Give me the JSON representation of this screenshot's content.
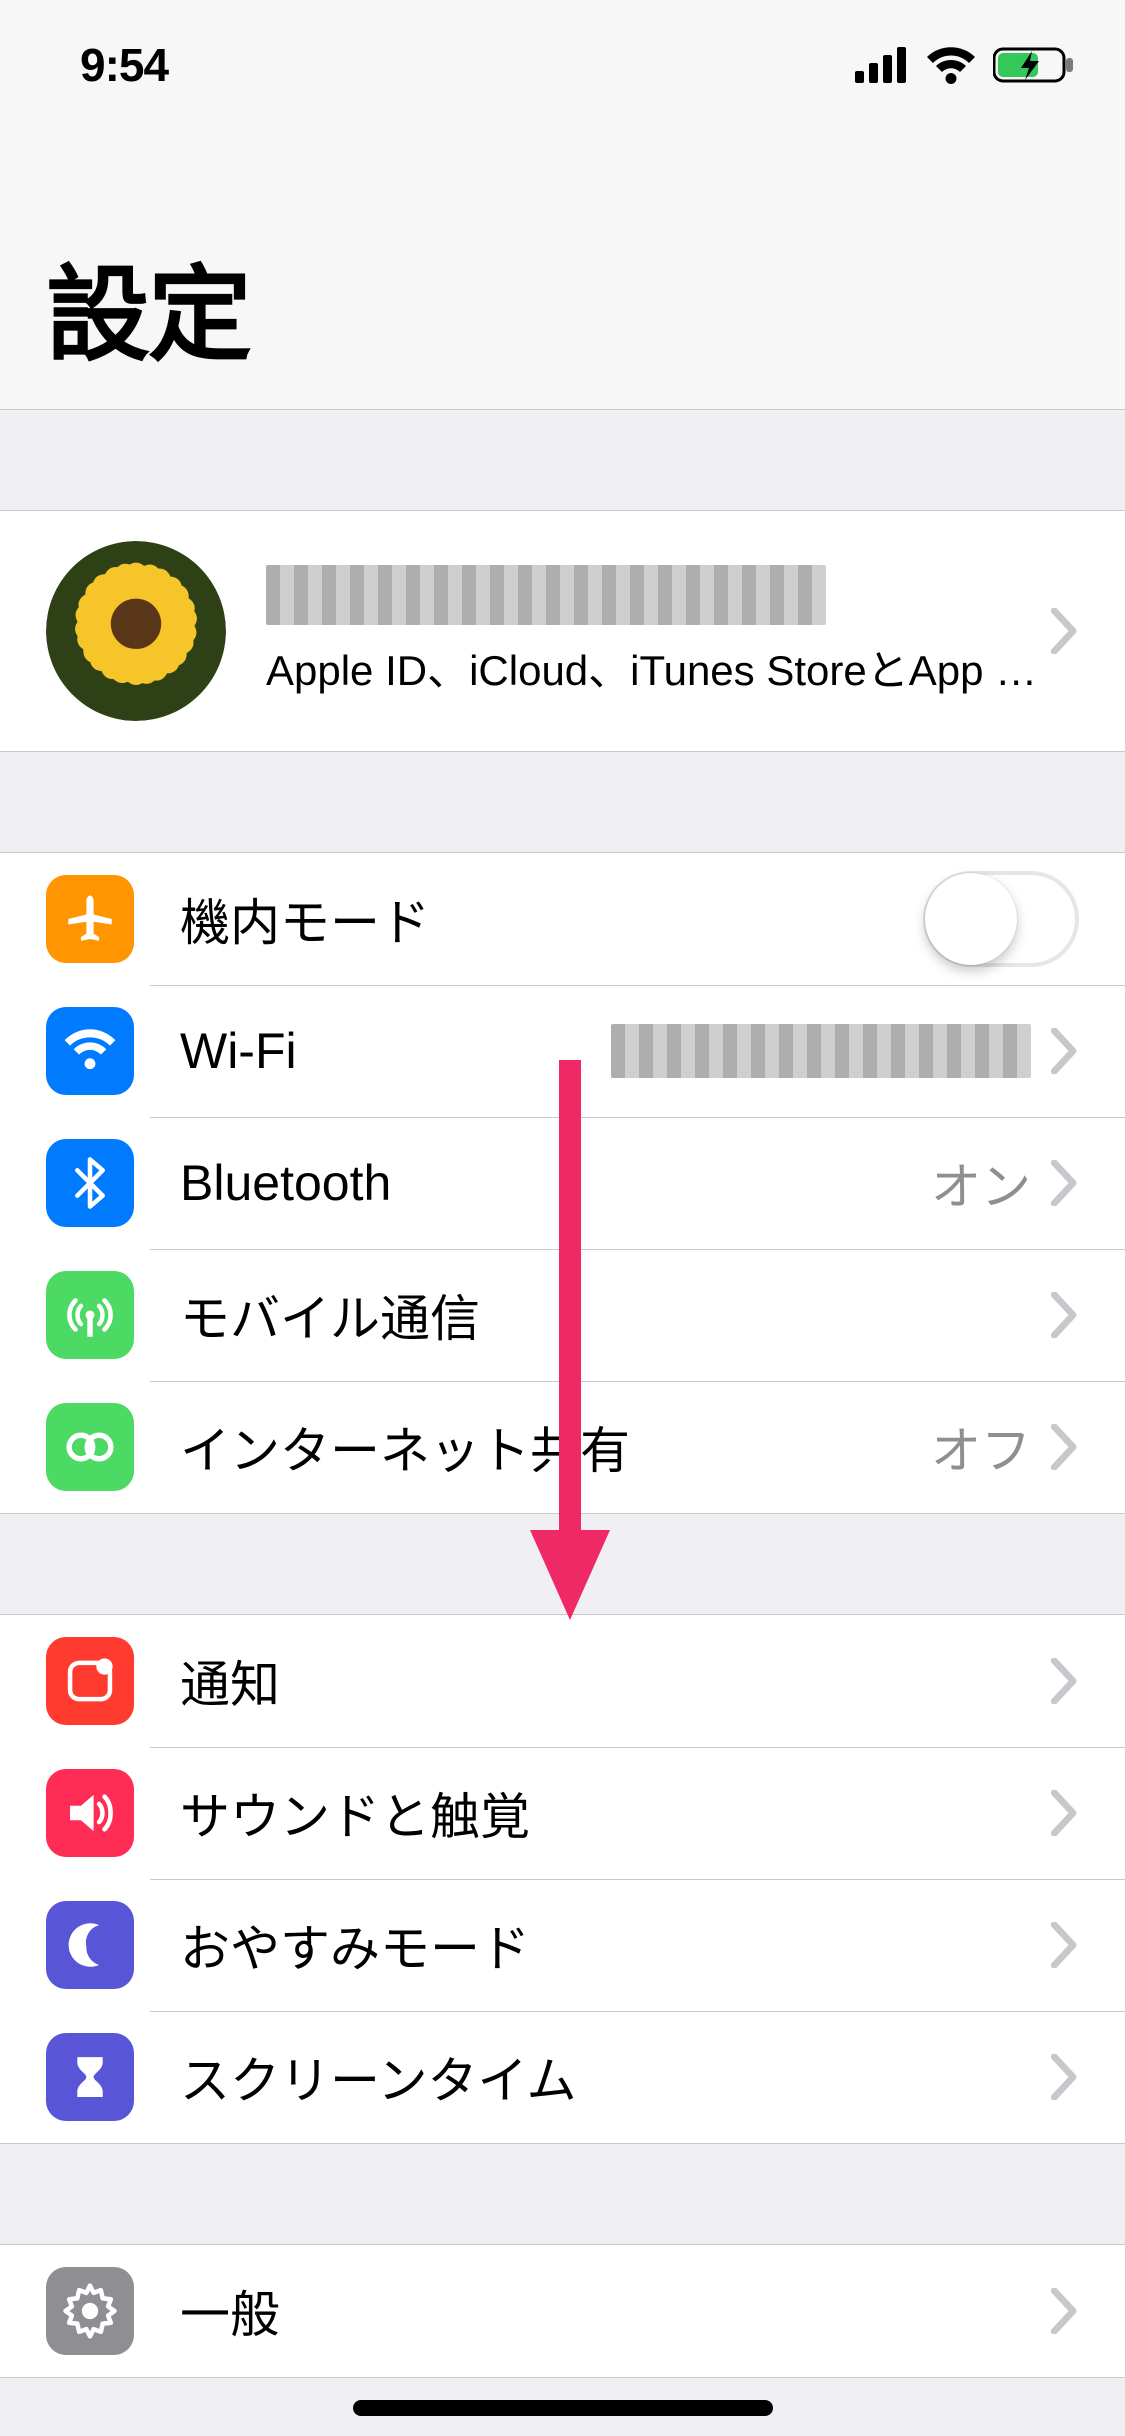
{
  "status": {
    "time": "9:54"
  },
  "header": {
    "title": "設定"
  },
  "profile": {
    "subtitle": "Apple ID、iCloud、iTunes StoreとApp S..."
  },
  "group_connectivity": {
    "airplane": {
      "label": "機内モード",
      "toggle": false
    },
    "wifi": {
      "label": "Wi-Fi"
    },
    "bluetooth": {
      "label": "Bluetooth",
      "value": "オン"
    },
    "cellular": {
      "label": "モバイル通信"
    },
    "hotspot": {
      "label": "インターネット共有",
      "value": "オフ"
    }
  },
  "group_notify": {
    "notifications": {
      "label": "通知"
    },
    "sounds": {
      "label": "サウンドと触覚"
    },
    "dnd": {
      "label": "おやすみモード"
    },
    "screentime": {
      "label": "スクリーンタイム"
    }
  },
  "group_general": {
    "general": {
      "label": "一般"
    }
  }
}
